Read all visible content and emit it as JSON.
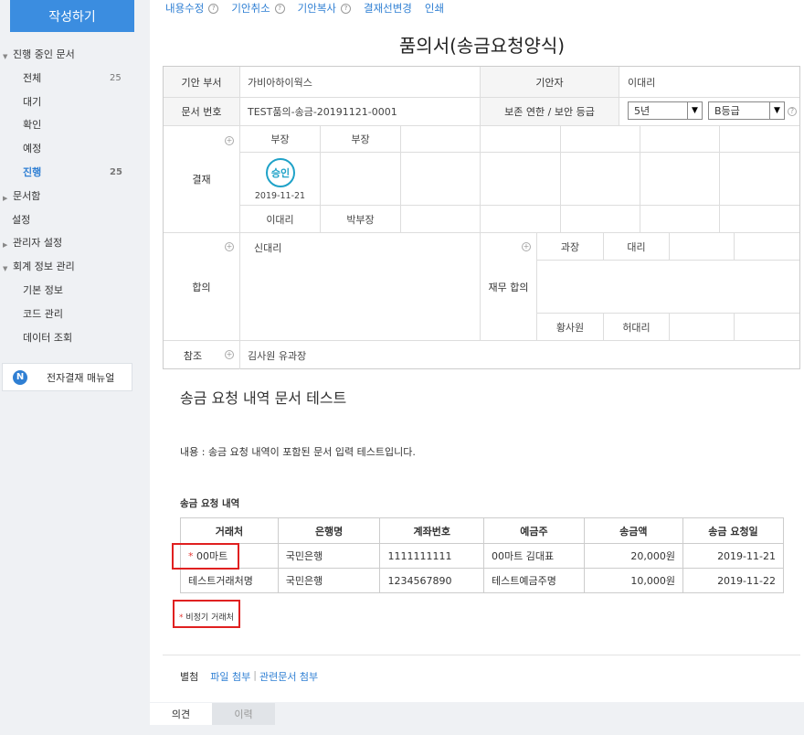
{
  "sidebar": {
    "write_button": "작성하기",
    "menu": [
      {
        "label": "진행 중인 문서",
        "level": "l1",
        "tri": "▼"
      },
      {
        "label": "전체",
        "level": "l2",
        "count": "25"
      },
      {
        "label": "대기",
        "level": "l2"
      },
      {
        "label": "확인",
        "level": "l2"
      },
      {
        "label": "예정",
        "level": "l2"
      },
      {
        "label": "진행",
        "level": "l2",
        "count": "25",
        "active": true
      },
      {
        "label": "문서함",
        "level": "l1",
        "tri": "▶"
      },
      {
        "label": "설정",
        "level": "l0"
      },
      {
        "label": "관리자 설정",
        "level": "l1",
        "tri": "▶"
      },
      {
        "label": "회계 정보 관리",
        "level": "l1",
        "tri": "▼"
      },
      {
        "label": "기본 정보",
        "level": "l2"
      },
      {
        "label": "코드 관리",
        "level": "l2"
      },
      {
        "label": "데이터 조회",
        "level": "l2"
      }
    ],
    "manual_icon": "N",
    "manual_label": "전자결재 매뉴얼"
  },
  "toolbar": {
    "edit": "내용수정",
    "cancel": "기안취소",
    "copy": "기안복사",
    "line_change": "결재선변경",
    "print": "인쇄",
    "help": "?"
  },
  "doc": {
    "title": "품의서(송금요청양식)",
    "dept_label": "기안 부서",
    "dept": "가비아하이웍스",
    "drafter_label": "기안자",
    "drafter": "이대리",
    "docno_label": "문서 번호",
    "docno": "TEST품의-송금-20191121-0001",
    "retention_label": "보존 연한 / 보안 등급",
    "retention": "5년",
    "security": "B등급",
    "approval_label": "결재",
    "approval_roles": [
      "부장",
      "부장"
    ],
    "stamp": "승인",
    "approval_date": "2019-11-21",
    "approval_names": [
      "이대리",
      "박부장"
    ],
    "agreement_label": "합의",
    "agreement_names": "신대리",
    "finance_label": "재무 합의",
    "finance_roles": [
      "과장",
      "대리"
    ],
    "finance_names": [
      "황사원",
      "허대리"
    ],
    "ref_label": "참조",
    "ref": "김사원 유과장"
  },
  "content": {
    "title": "송금 요청 내역 문서 테스트",
    "text": "내용 : 송금 요청 내역이 포함된 문서 입력 테스트입니다.",
    "section": "송금 요청 내역",
    "columns": [
      "거래처",
      "은행명",
      "계좌번호",
      "예금주",
      "송금액",
      "송금 요청일"
    ],
    "rows": [
      {
        "vendor_mark": "*",
        "vendor": "00마트",
        "bank": "국민은행",
        "account": "1111111111",
        "holder": "00마트 김대표",
        "amount": "20,000원",
        "date": "2019-11-21"
      },
      {
        "vendor_mark": "",
        "vendor": "테스트거래처명",
        "bank": "국민은행",
        "account": "1234567890",
        "holder": "테스트예금주명",
        "amount": "10,000원",
        "date": "2019-11-22"
      }
    ],
    "note_mark": "*",
    "note": "비정기 거래처"
  },
  "attachments": {
    "label": "별첨",
    "file": "파일 첨부",
    "separator": "|",
    "related": "관련문서 첨부"
  },
  "tabs": {
    "opinion": "의견",
    "history": "이력"
  },
  "colors": {
    "accent": "#3b8de0",
    "link": "#2f7fd3",
    "stamp": "#1fa2c8",
    "highlight": "#e02020"
  }
}
